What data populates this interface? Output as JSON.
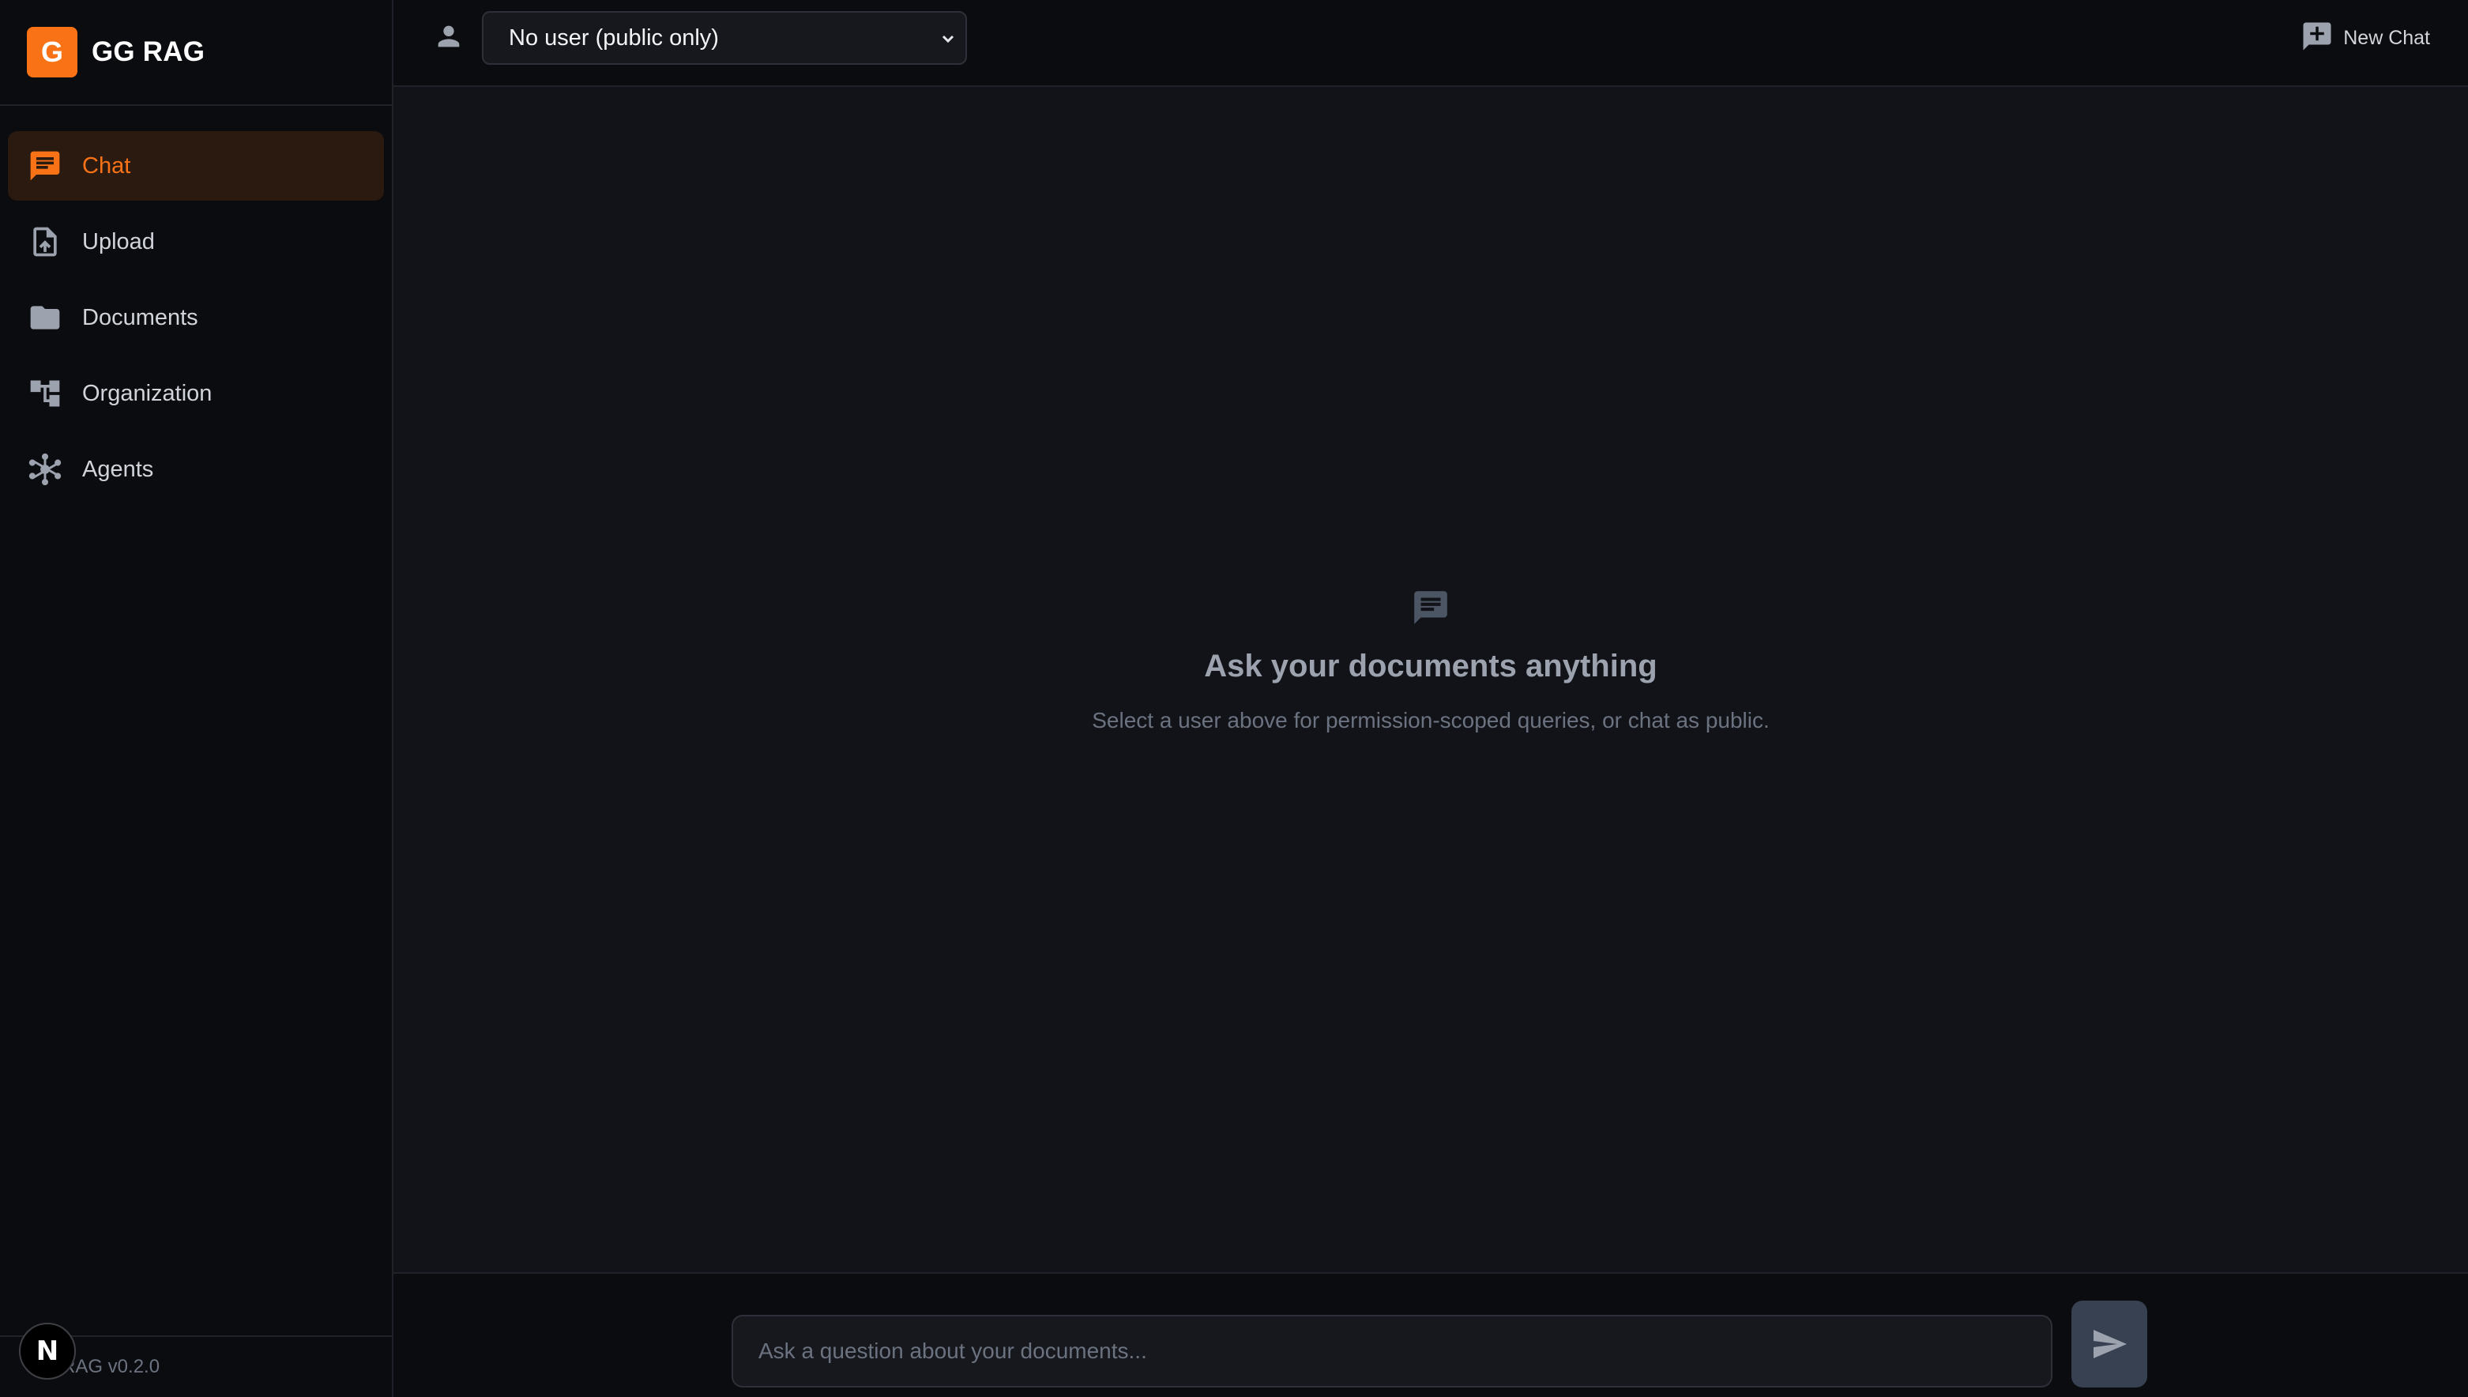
{
  "brand": {
    "logo_letter": "G",
    "name": "GG RAG"
  },
  "sidebar": {
    "items": [
      {
        "label": "Chat",
        "icon": "chat-icon",
        "active": true
      },
      {
        "label": "Upload",
        "icon": "upload-file-icon",
        "active": false
      },
      {
        "label": "Documents",
        "icon": "folder-icon",
        "active": false
      },
      {
        "label": "Organization",
        "icon": "org-tree-icon",
        "active": false
      },
      {
        "label": "Agents",
        "icon": "network-hub-icon",
        "active": false
      }
    ],
    "version": "GG RAG v0.2.0",
    "badge_letter": "N"
  },
  "header": {
    "user_select_value": "No user (public only)",
    "new_chat_label": "New Chat"
  },
  "empty_state": {
    "title": "Ask your documents anything",
    "subtitle": "Select a user above for permission-scoped queries, or chat as public."
  },
  "composer": {
    "placeholder": "Ask a question about your documents..."
  },
  "colors": {
    "accent": "#f97316",
    "sidebar_bg": "#0b0c0f",
    "main_bg": "#111318",
    "active_nav_bg": "#2a1a10"
  }
}
